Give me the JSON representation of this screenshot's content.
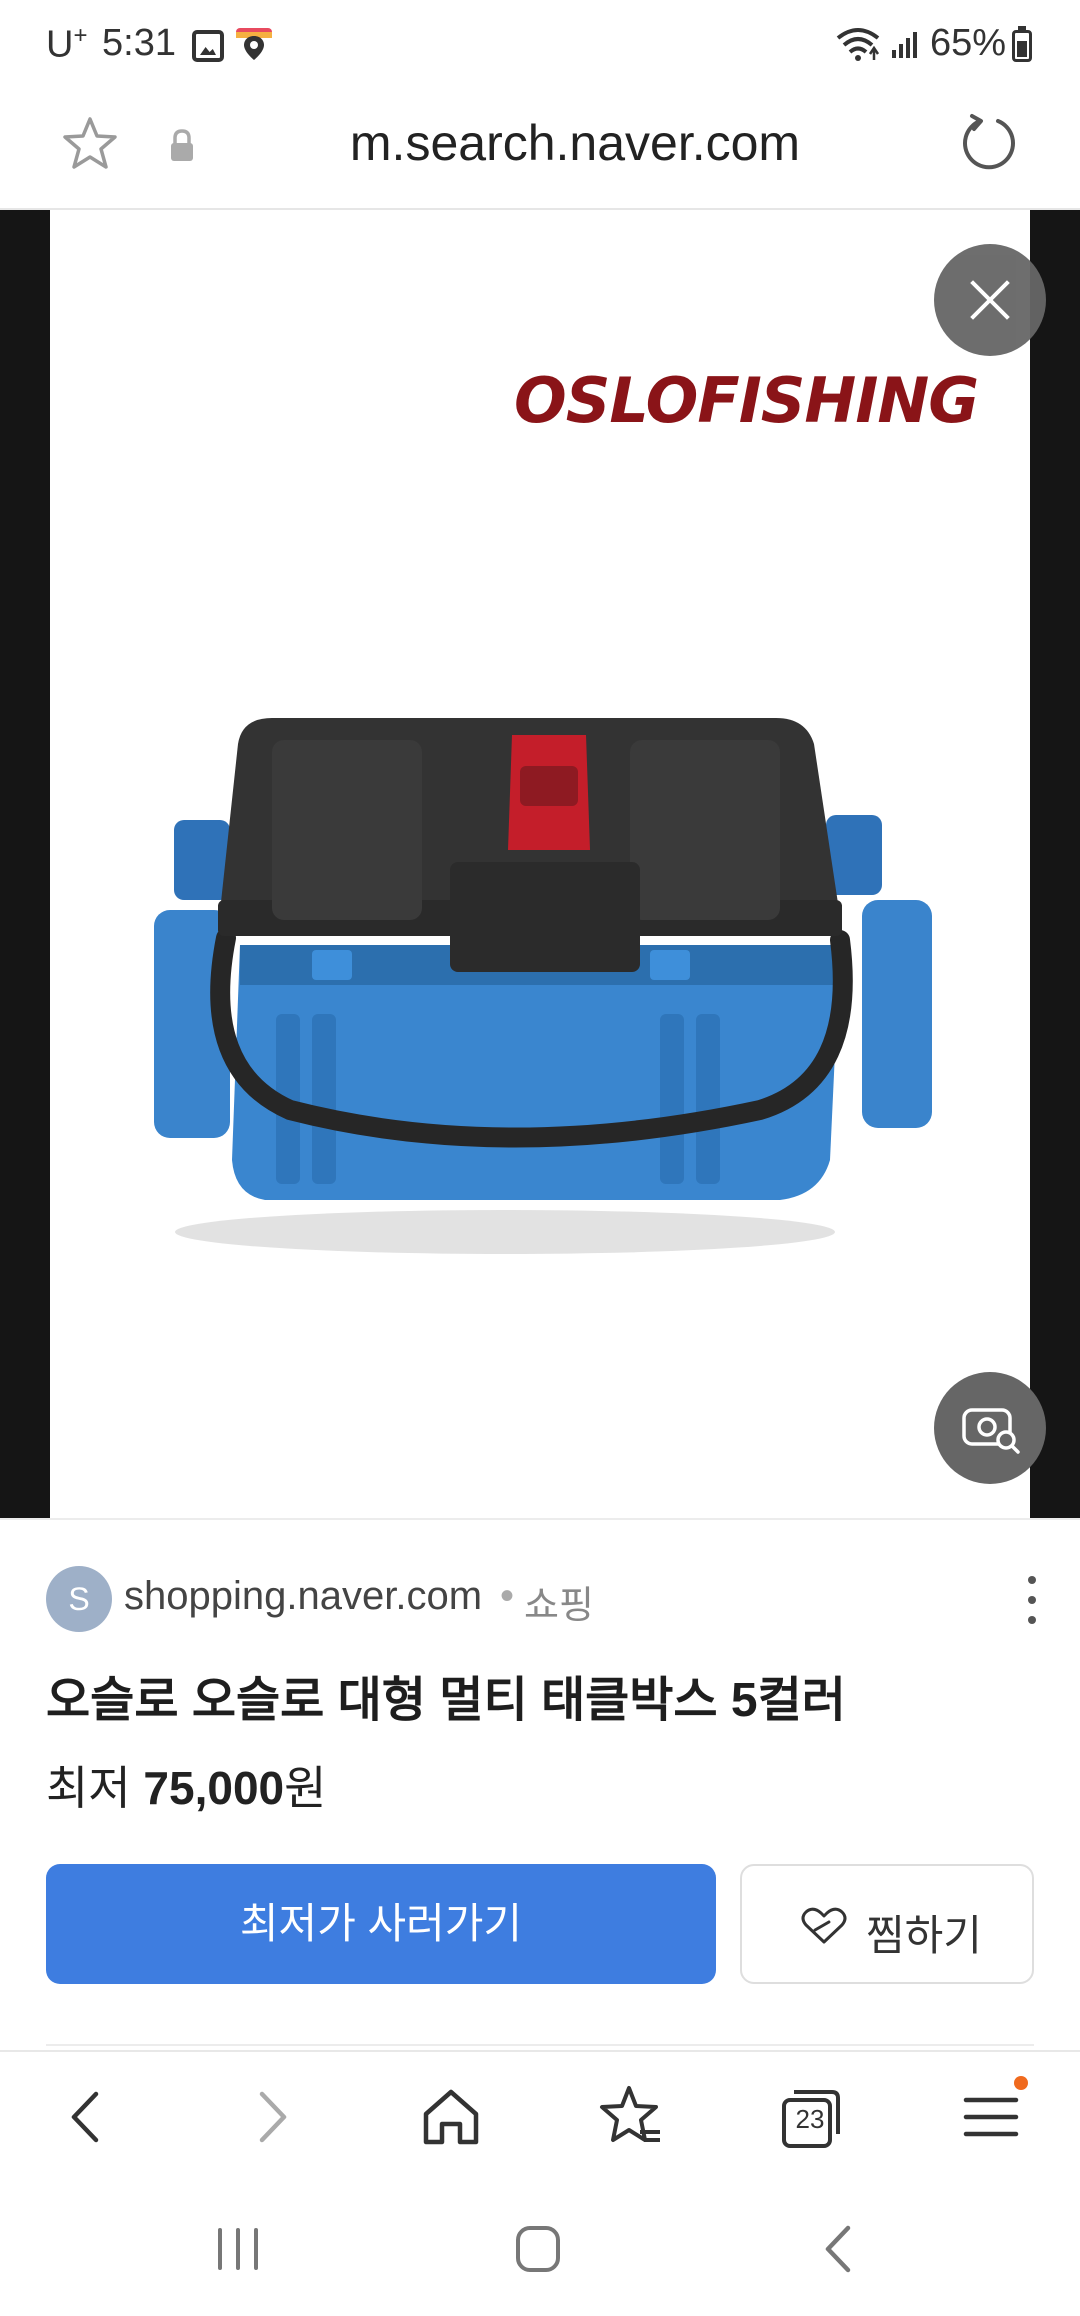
{
  "status_bar": {
    "carrier": "U",
    "carrier_mark": "+",
    "time": "5:31",
    "battery": "65%"
  },
  "url_bar": {
    "url": "m.search.naver.com"
  },
  "image": {
    "brand_text": "OSLOFISHING"
  },
  "result": {
    "source_initial": "S",
    "source_domain": "shopping.naver.com",
    "separator": "•",
    "category": "쇼핑",
    "title": "오슬로 오슬로 대형 멀티 태클박스 5컬러",
    "price_prefix": "최저",
    "price_amount": "75,000",
    "price_unit": "원",
    "buy_label": "최저가 사러가기",
    "save_label": "찜하기"
  },
  "browser_nav": {
    "tabs_count": "23"
  },
  "colors": {
    "accent": "#3e7de0",
    "brand_logo": "#8a1418",
    "notification_dot": "#f06a1e"
  }
}
